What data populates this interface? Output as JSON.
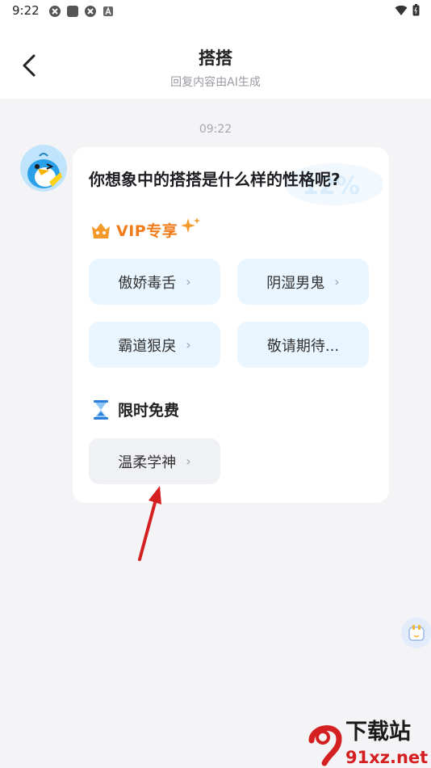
{
  "status_bar": {
    "time": "9:22"
  },
  "header": {
    "title": "搭搭",
    "subtitle": "回复内容由AI生成"
  },
  "chat": {
    "time": "09:22"
  },
  "card": {
    "question": "你想象中的搭搭是什么样的性格呢?",
    "vip_section_label": "VIP专享",
    "vip_options": [
      {
        "label": "傲娇毒舌",
        "chevron": "›"
      },
      {
        "label": "阴湿男鬼",
        "chevron": "›"
      },
      {
        "label": "霸道狠戾",
        "chevron": "›"
      },
      {
        "label": "敬请期待..."
      }
    ],
    "free_section_label": "限时免费",
    "free_options": [
      {
        "label": "温柔学神",
        "chevron": "›"
      }
    ]
  },
  "watermark": {
    "brand": "下载站",
    "domain": "91xz.net"
  },
  "colors": {
    "vip_orange": "#f07d1c",
    "vip_option_bg": "#e9f5ff",
    "free_option_bg": "#eff1f4",
    "arrow_red": "#d42020"
  }
}
